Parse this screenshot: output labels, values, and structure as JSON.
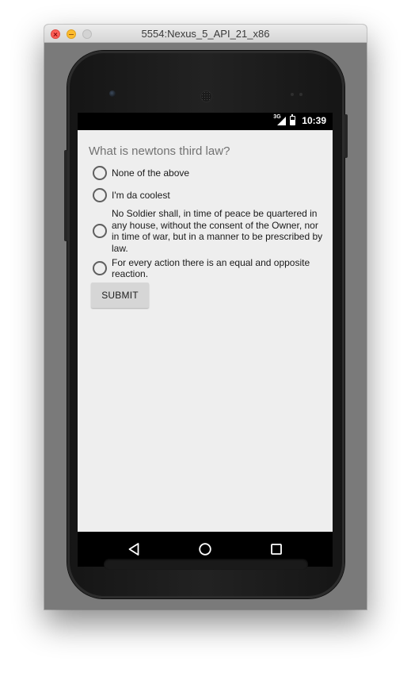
{
  "window": {
    "title": "5554:Nexus_5_API_21_x86"
  },
  "status_bar": {
    "network": "3G",
    "time": "10:39"
  },
  "quiz": {
    "question": "What is newtons third law?",
    "options": [
      {
        "label": "None of the above"
      },
      {
        "label": "I'm da coolest"
      },
      {
        "label": "No Soldier shall, in time of peace be quartered in any house, without the consent of the Owner, nor in time of war, but in a manner to be prescribed by law."
      },
      {
        "label": "For every action there is an equal and opposite reaction."
      }
    ],
    "submit_label": "SUBMIT"
  },
  "icons": {
    "back": "back-triangle-icon",
    "home": "home-circle-icon",
    "recents": "recents-square-icon",
    "signal": "signal-icon",
    "battery": "battery-icon"
  },
  "colors": {
    "app_background": "#eeeeee",
    "question_text": "#727272",
    "button_background": "#d6d6d6",
    "emulator_background": "#7a7a7a"
  }
}
